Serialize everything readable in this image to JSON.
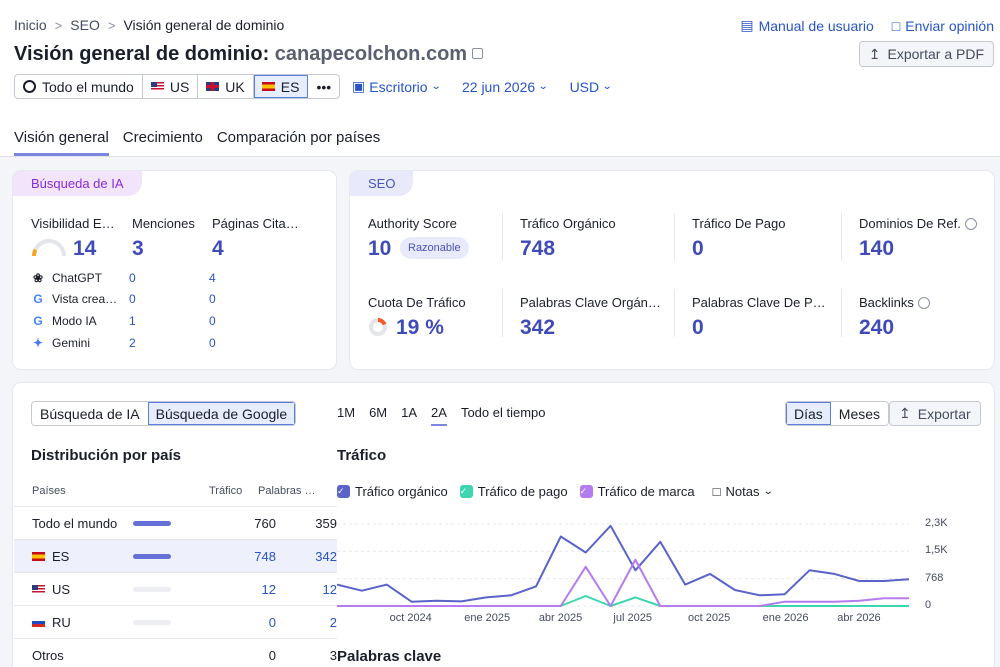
{
  "breadcrumb": {
    "items": [
      "Inicio",
      "SEO"
    ],
    "current": "Visión general de dominio"
  },
  "header": {
    "title_prefix": "Visión general de dominio:",
    "domain": "canapecolchon.com",
    "manual": "Manual de usuario",
    "feedback": "Enviar opinión",
    "export_pdf": "Exportar a PDF"
  },
  "databases": [
    {
      "label": "Todo el mundo"
    },
    {
      "label": "US"
    },
    {
      "label": "UK"
    },
    {
      "label": "ES"
    }
  ],
  "more": "•••",
  "device": "Escritorio",
  "date": "22 jun 2026",
  "currency": "USD",
  "tabs": [
    "Visión general",
    "Crecimiento",
    "Comparación por países"
  ],
  "ai": {
    "pill": "Búsqueda de IA",
    "visibility": {
      "label": "Visibilidad E…",
      "value": "14",
      "level": 0.14
    },
    "mentions": {
      "label": "Menciones",
      "value": "3"
    },
    "pages": {
      "label": "Páginas Cita…",
      "value": "4"
    },
    "rows": [
      {
        "name": "ChatGPT",
        "a": "0",
        "b": "4"
      },
      {
        "name": "Vista crea…",
        "a": "0",
        "b": "0"
      },
      {
        "name": "Modo IA",
        "a": "1",
        "b": "0"
      },
      {
        "name": "Gemini",
        "a": "2",
        "b": "0"
      }
    ]
  },
  "seo": {
    "pill": "SEO",
    "authority": {
      "label": "Authority Score",
      "value": "10",
      "badge": "Razonable"
    },
    "organic": {
      "label": "Tráfico Orgánico",
      "value": "748"
    },
    "paid": {
      "label": "Tráfico De Pago",
      "value": "0"
    },
    "refdomains": {
      "label": "Dominios De Ref.",
      "value": "140"
    },
    "share": {
      "label": "Cuota De Tráfico",
      "value": "19 %",
      "level": 0.19
    },
    "orgkw": {
      "label": "Palabras Clave Orgán…",
      "value": "342"
    },
    "paidkw": {
      "label": "Palabras Clave De P…",
      "value": "0"
    },
    "backlinks": {
      "label": "Backlinks",
      "value": "240"
    }
  },
  "switcher": {
    "ai": "Búsqueda de IA",
    "google": "Búsqueda de Google"
  },
  "distribution": {
    "title": "Distribución por país",
    "headers": [
      "Países",
      "Tráfico",
      "Palabras …"
    ],
    "rows": [
      {
        "name": "Todo el mundo",
        "traffic": "760",
        "kw": "359",
        "share": 1.0
      },
      {
        "name": "ES",
        "traffic": "748",
        "kw": "342",
        "share": 0.98
      },
      {
        "name": "US",
        "traffic": "12",
        "kw": "12",
        "share": 0.016
      },
      {
        "name": "RU",
        "traffic": "0",
        "kw": "2",
        "share": 0
      },
      {
        "name": "Otros",
        "traffic": "0",
        "kw": "3",
        "share": 0
      }
    ]
  },
  "periods": [
    "1M",
    "6M",
    "1A",
    "2A",
    "Todo el tiempo"
  ],
  "view": {
    "days": "Días",
    "months": "Meses",
    "export": "Exportar"
  },
  "traffic": {
    "title": "Tráfico",
    "legend": [
      "Tráfico orgánico",
      "Tráfico de pago",
      "Tráfico de marca"
    ],
    "notes": "Notas"
  },
  "keywords_title": "Palabras clave",
  "colors": {
    "organic": "#5a63c9",
    "paid": "#3ed6b0",
    "brand": "#b57cf0",
    "accent": "#2854c5"
  },
  "chart_data": {
    "type": "line",
    "x": [
      "2024-07",
      "2024-08",
      "2024-09",
      "2024-10",
      "2024-11",
      "2024-12",
      "2025-01",
      "2025-02",
      "2025-03",
      "2025-04",
      "2025-05",
      "2025-06",
      "2025-07",
      "2025-08",
      "2025-09",
      "2025-10",
      "2025-11",
      "2025-12",
      "2026-01",
      "2026-02",
      "2026-03",
      "2026-04",
      "2026-05",
      "2026-06"
    ],
    "xticks": [
      "oct 2024",
      "ene 2025",
      "abr 2025",
      "jul 2025",
      "oct 2025",
      "ene 2026",
      "abr 2026"
    ],
    "yticks": [
      "0",
      "768",
      "1,5K",
      "2,3K"
    ],
    "ylim": [
      0,
      2300
    ],
    "series": [
      {
        "name": "Tráfico orgánico",
        "values": [
          600,
          430,
          600,
          120,
          150,
          130,
          240,
          300,
          550,
          1950,
          1500,
          2250,
          1000,
          1800,
          600,
          900,
          450,
          300,
          330,
          1000,
          900,
          700,
          700,
          748
        ]
      },
      {
        "name": "Tráfico de pago",
        "values": [
          0,
          0,
          0,
          0,
          0,
          0,
          0,
          0,
          0,
          0,
          280,
          0,
          240,
          0,
          0,
          0,
          0,
          0,
          0,
          0,
          0,
          0,
          0,
          0
        ]
      },
      {
        "name": "Tráfico de marca",
        "values": [
          0,
          0,
          0,
          0,
          0,
          0,
          0,
          0,
          0,
          0,
          1100,
          0,
          1300,
          0,
          0,
          0,
          0,
          0,
          120,
          120,
          120,
          150,
          220,
          220
        ]
      }
    ]
  }
}
